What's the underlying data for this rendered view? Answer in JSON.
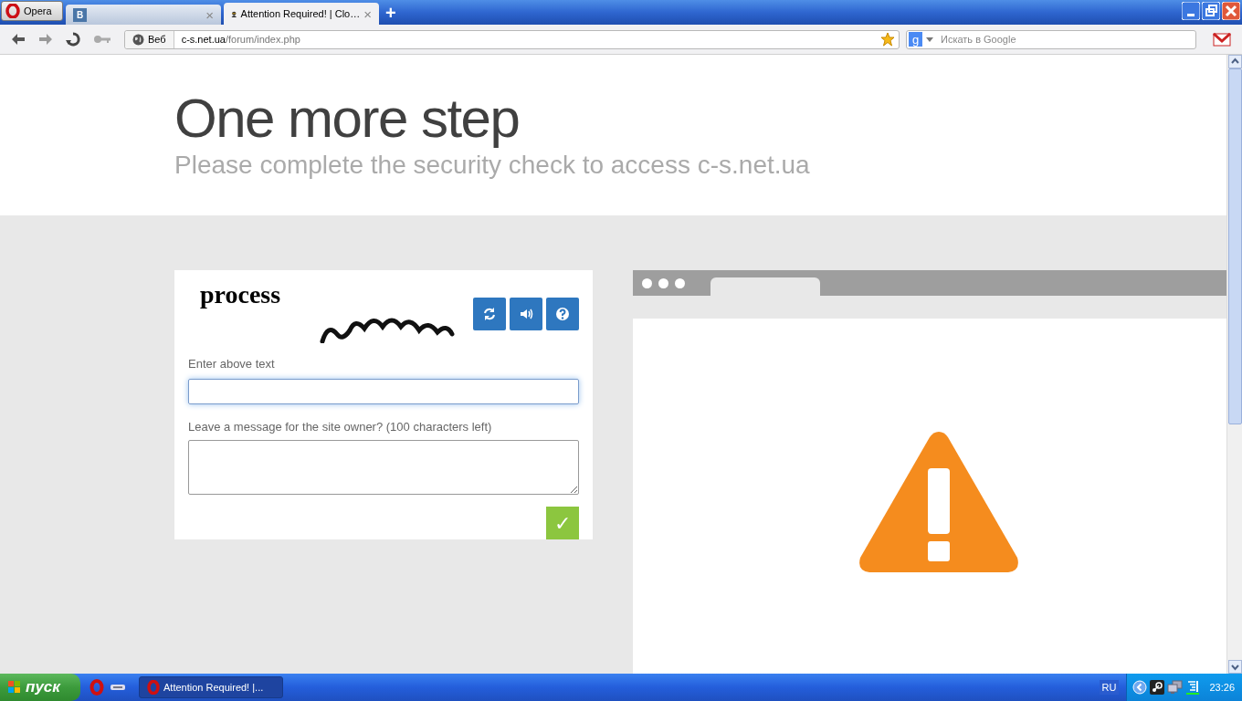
{
  "title_bar": {
    "menu_button": "Opera",
    "tabs": [
      {
        "icon_text": "В",
        "selected": false,
        "close": "×"
      },
      {
        "label": "Attention Required! | Clo…",
        "selected": true,
        "close": "×"
      }
    ],
    "new_tab": "+"
  },
  "address_bar": {
    "site_label": "Веб",
    "url_host": "c-s.net.ua",
    "url_path": "/forum/index.php",
    "search_engine_text": "g",
    "search_placeholder": "Искать в Google"
  },
  "page": {
    "heading": "One more step",
    "subheading": "Please complete the security check to access c-s.net.ua",
    "captcha": {
      "word": "process",
      "answer_label": "Enter above text",
      "message_label": "Leave a message for the site owner? (100 characters left)",
      "submit": "✓"
    }
  },
  "taskbar": {
    "start": "пуск",
    "tasks": [
      {
        "label": "Attention Required! |...",
        "selected": true
      }
    ],
    "language": "RU",
    "clock": "23:26"
  }
}
